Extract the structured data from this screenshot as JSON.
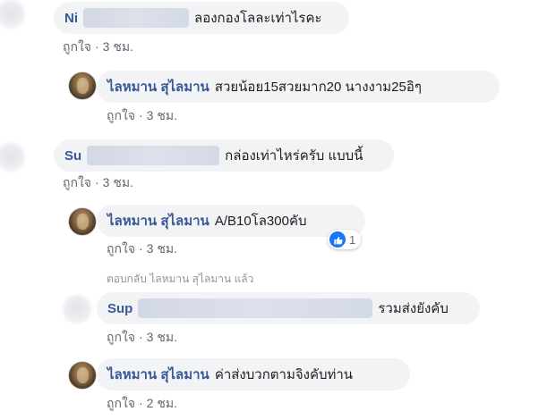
{
  "comments": [
    {
      "author": "Ni",
      "text": "ลองกองโลละเท่าไรคะ",
      "like_label": "ถูกใจ",
      "time": "3 ชม."
    },
    {
      "author": "ไลหมาน สุไลมาน",
      "text": "สวยน้อย15สวยมาก20 นางงาม25อิๆ",
      "like_label": "ถูกใจ",
      "time": "3 ชม."
    },
    {
      "author": "Su",
      "text": "กล่องเท่าไหร่ครับ แบบนี้",
      "like_label": "ถูกใจ",
      "time": "3 ชม."
    },
    {
      "author": "ไลหมาน สุไลมาน",
      "text": "A/B10โล300คับ",
      "like_label": "ถูกใจ",
      "time": "3 ชม.",
      "reaction_count": "1"
    },
    {
      "author": "Sup",
      "text": "รวมส่งยังคับ",
      "like_label": "ถูกใจ",
      "time": "3 ชม."
    },
    {
      "author": "ไลหมาน สุไลมาน",
      "text": "ค่าส่งบวกตามจิงคับท่าน",
      "like_label": "ถูกใจ",
      "time": "2 ชม."
    }
  ],
  "reply_notice": "ตอบกลับ ไลหมาน สุไลมาน แล้ว",
  "separator": "·",
  "colors": {
    "author": "#385898",
    "bubble": "#f2f3f5",
    "meta": "#606770",
    "like_reaction": "#1877f2"
  }
}
